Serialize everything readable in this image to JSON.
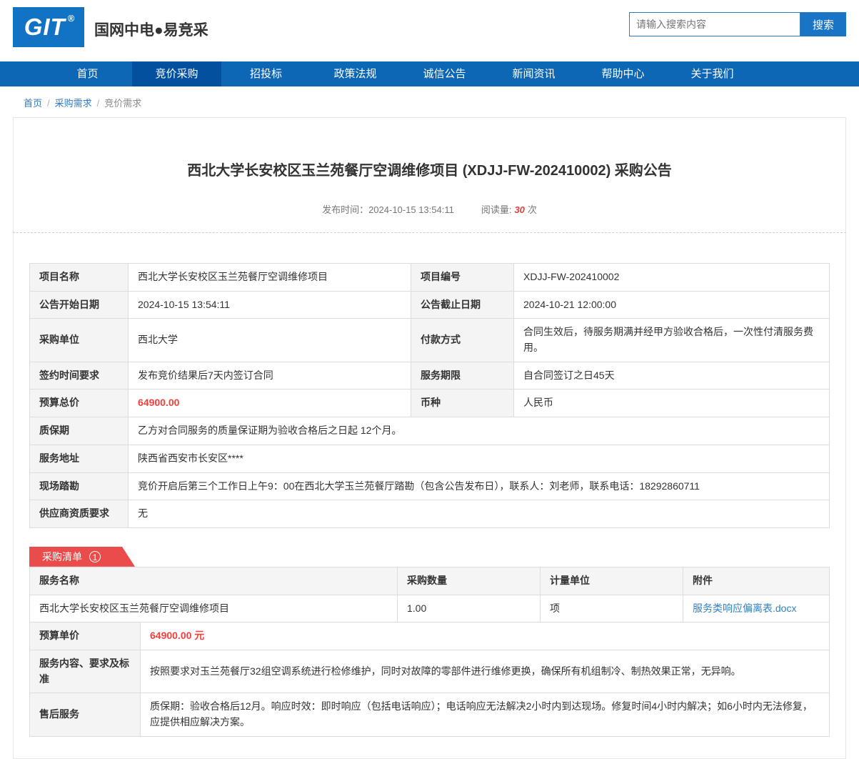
{
  "header": {
    "logo_text": "GIT",
    "logo_reg": "®",
    "brand": "国网中电●易竞采",
    "search_placeholder": "请输入搜索内容",
    "search_button": "搜索"
  },
  "nav": {
    "items": [
      {
        "label": "首页",
        "active": false
      },
      {
        "label": "竞价采购",
        "active": true
      },
      {
        "label": "招投标",
        "active": false
      },
      {
        "label": "政策法规",
        "active": false
      },
      {
        "label": "诚信公告",
        "active": false
      },
      {
        "label": "新闻资讯",
        "active": false
      },
      {
        "label": "帮助中心",
        "active": false
      },
      {
        "label": "关于我们",
        "active": false
      }
    ]
  },
  "breadcrumb": {
    "home": "首页",
    "sep": "/",
    "level2": "采购需求",
    "current": "竞价需求"
  },
  "announcement": {
    "title": "西北大学长安校区玉兰苑餐厅空调维修项目 (XDJJ-FW-202410002) 采购公告",
    "publish_label": "发布时间：",
    "publish_time": "2024-10-15 13:54:11",
    "views_label": "阅读量:",
    "views_count": "30",
    "views_unit": "次"
  },
  "info": {
    "rows": [
      {
        "l1": "项目名称",
        "v1": "西北大学长安校区玉兰苑餐厅空调维修项目",
        "l2": "项目编号",
        "v2": "XDJJ-FW-202410002"
      },
      {
        "l1": "公告开始日期",
        "v1": "2024-10-15 13:54:11",
        "l2": "公告截止日期",
        "v2": "2024-10-21 12:00:00"
      },
      {
        "l1": "采购单位",
        "v1": "西北大学",
        "l2": "付款方式",
        "v2": "合同生效后，待服务期满并经甲方验收合格后，一次性付清服务费用。"
      },
      {
        "l1": "签约时间要求",
        "v1": "发布竞价结果后7天内签订合同",
        "l2": "服务期限",
        "v2": "自合同签订之日45天"
      },
      {
        "l1": "预算总价",
        "v1": "64900.00",
        "l2": "币种",
        "v2": "人民币"
      }
    ],
    "full_rows": [
      {
        "label": "质保期",
        "value": "乙方对合同服务的质量保证期为验收合格后之日起 12个月。"
      },
      {
        "label": "服务地址",
        "value": "陕西省西安市长安区****"
      },
      {
        "label": "现场踏勘",
        "value": "竞价开启后第三个工作日上午9：00在西北大学玉兰苑餐厅踏勘（包含公告发布日），联系人：刘老师，联系电话：18292860711"
      },
      {
        "label": "供应商资质要求",
        "value": "无"
      }
    ]
  },
  "list": {
    "badge_label": "采购清单",
    "badge_count": "1",
    "headers": [
      "服务名称",
      "采购数量",
      "计量单位",
      "附件"
    ],
    "row": {
      "name": "西北大学长安校区玉兰苑餐厅空调维修项目",
      "qty": "1.00",
      "unit": "项",
      "attachment": "服务类响应偏离表.docx"
    },
    "detail_rows": [
      {
        "label": "预算单价",
        "value": "64900.00 元"
      },
      {
        "label": "服务内容、要求及标准",
        "value": "按照要求对玉兰苑餐厅32组空调系统进行检修维护，同时对故障的零部件进行维修更换，确保所有机组制冷、制热效果正常，无异响。"
      },
      {
        "label": "售后服务",
        "value": "质保期：验收合格后12月。响应时效：即时响应（包括电话响应）；电话响应无法解决2小时内到达现场。修复时间4小时内解决；如6小时内无法修复，应提供相应解决方案。"
      }
    ]
  },
  "colors": {
    "nav_blue": "#0d67b5",
    "nav_active_blue": "#03519e",
    "logo_blue": "#1273c4",
    "search_button_blue": "#1a74c5",
    "price_red": "#f0413c",
    "badge_red": "#ea4c4c",
    "link_blue": "#2f81c4",
    "views_red": "#e23b3b"
  }
}
